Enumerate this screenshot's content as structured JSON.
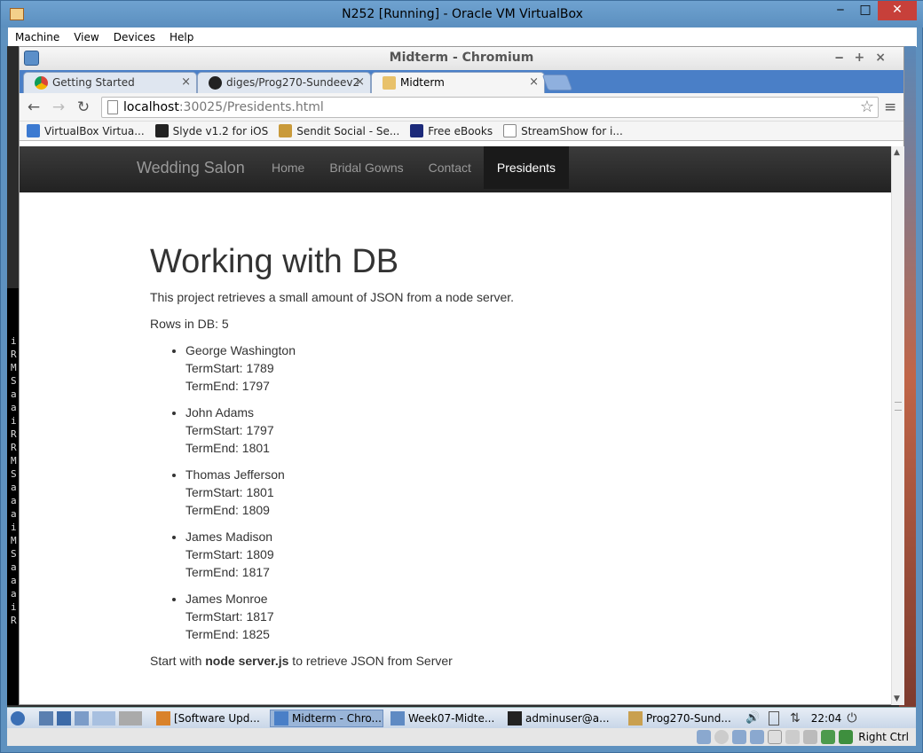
{
  "host_window": {
    "title": "N252 [Running] - Oracle VM VirtualBox",
    "menu": [
      "Machine",
      "View",
      "Devices",
      "Help"
    ],
    "minimize": "‒",
    "maximize": "□",
    "close": "✕"
  },
  "browser": {
    "title": "Midterm - Chromium",
    "tabs": [
      {
        "label": "Getting Started",
        "close": "×"
      },
      {
        "label": "diges/Prog270-Sundeev2",
        "close": "×"
      },
      {
        "label": "Midterm",
        "close": "×"
      }
    ],
    "url_host": "localhost",
    "url_path": ":30025/Presidents.html",
    "bookmarks": [
      "VirtualBox Virtua...",
      "Slyde v1.2 for iOS",
      "Sendit Social - Se...",
      "Free eBooks",
      "StreamShow for i..."
    ]
  },
  "site": {
    "brand": "Wedding Salon",
    "nav": [
      "Home",
      "Bridal Gowns",
      "Contact",
      "Presidents"
    ],
    "heading": "Working with DB",
    "intro": "This project retrieves a small amount of JSON from a node server.",
    "rows_label": "Rows in DB: 5",
    "presidents": [
      {
        "name": "George Washington",
        "start": "TermStart: 1789",
        "end": "TermEnd: 1797"
      },
      {
        "name": "John Adams",
        "start": "TermStart: 1797",
        "end": "TermEnd: 1801"
      },
      {
        "name": "Thomas Jefferson",
        "start": "TermStart: 1801",
        "end": "TermEnd: 1809"
      },
      {
        "name": "James Madison",
        "start": "TermStart: 1809",
        "end": "TermEnd: 1817"
      },
      {
        "name": "James Monroe",
        "start": "TermStart: 1817",
        "end": "TermEnd: 1825"
      }
    ],
    "footer_pre": "Start with ",
    "footer_bold": "node server.js",
    "footer_post": " to retrieve JSON from Server"
  },
  "taskbar": {
    "items": [
      "[Software Upd...",
      "Midterm - Chro...",
      "Week07-Midte...",
      "adminuser@a...",
      "Prog270-Sund..."
    ],
    "clock": "22:04"
  },
  "vbox_status": {
    "host_key": "Right Ctrl"
  },
  "terminal_chars": [
    "i",
    "R",
    "M",
    "S",
    "a",
    "a",
    "i",
    "R",
    "R",
    "M",
    "S",
    "a",
    "a",
    "a",
    "i",
    "M",
    "S",
    "a",
    "a",
    "a",
    "i",
    "R"
  ]
}
